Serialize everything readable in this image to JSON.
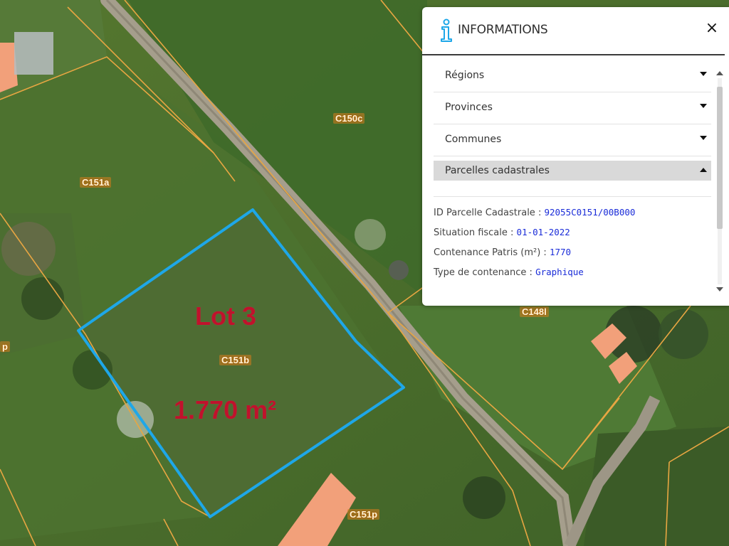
{
  "map": {
    "parcel_labels": [
      "C151a",
      "C150c",
      "C151b",
      "C148l",
      "C151p",
      "p"
    ],
    "annotations": {
      "lot": "Lot 3",
      "area": "1.770 m²"
    },
    "colors": {
      "parcel_border": "#e8a642",
      "selection": "#1ea7e8",
      "building": "#f2a07a",
      "annotation": "#c0122c"
    }
  },
  "panel": {
    "title": "INFORMATIONS",
    "icon": "info-icon",
    "close_label": "×",
    "accordion": [
      {
        "label": "Régions",
        "expanded": false
      },
      {
        "label": "Provinces",
        "expanded": false
      },
      {
        "label": "Communes",
        "expanded": false
      },
      {
        "label": "Parcelles cadastrales",
        "expanded": true
      }
    ],
    "details": [
      {
        "key": "ID Parcelle Cadastrale :",
        "value": "92055C0151/00B000"
      },
      {
        "key": "Situation fiscale :",
        "value": "01-01-2022"
      },
      {
        "key": "Contenance Patris (m²) :",
        "value": "1770"
      },
      {
        "key": "Type de contenance :",
        "value": "Graphique"
      }
    ],
    "accent_color": "#1ea7e8",
    "value_color": "#1a2cd8"
  }
}
